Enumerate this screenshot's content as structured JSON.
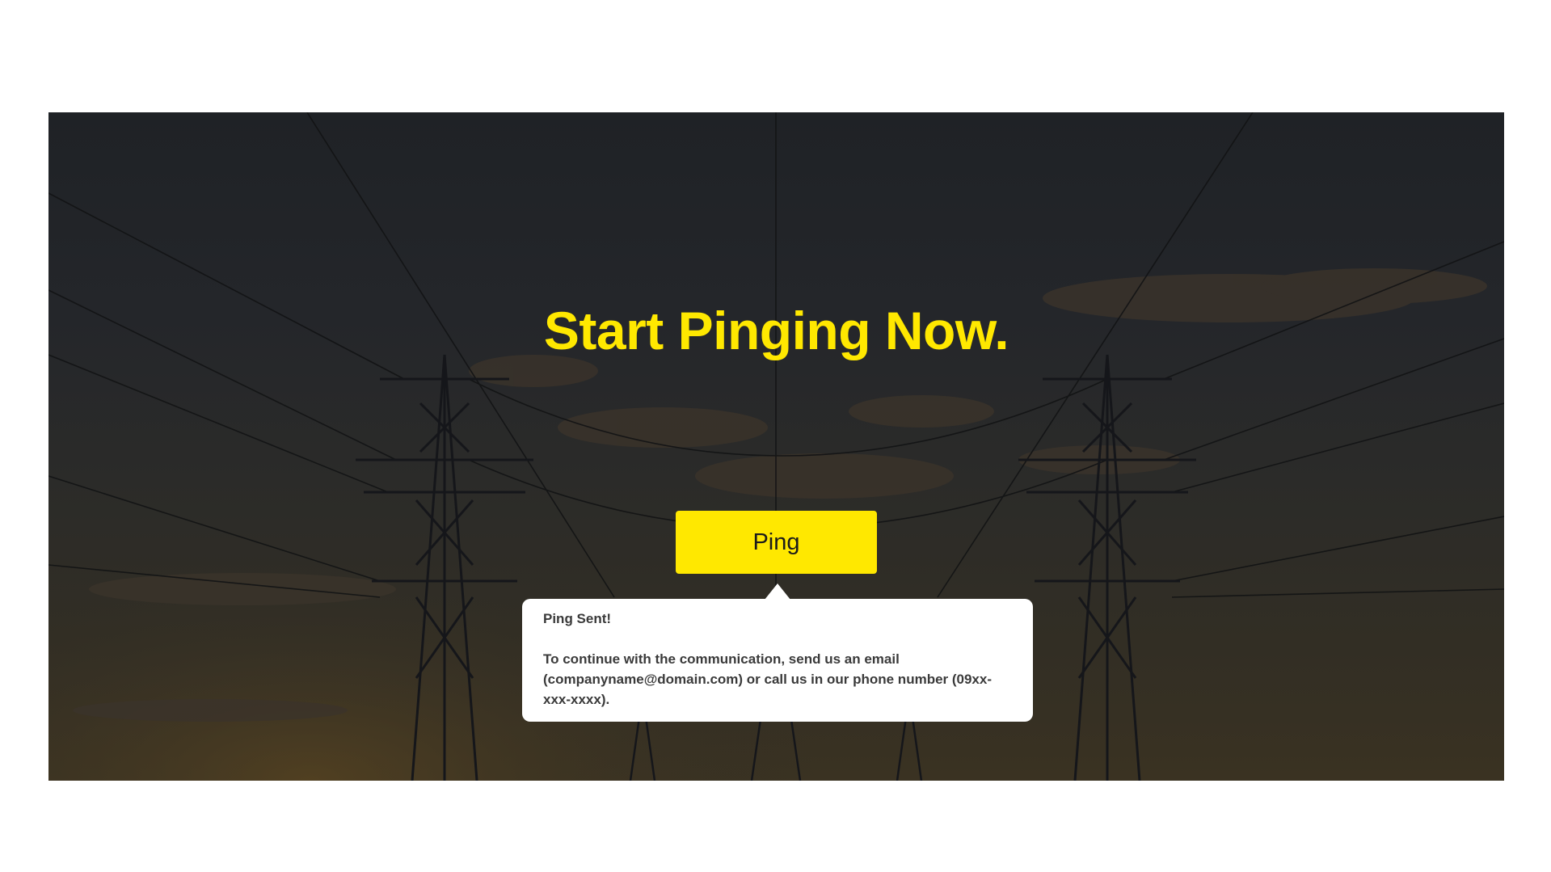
{
  "hero": {
    "title": "Start Pinging Now.",
    "title_color": "#ffe800"
  },
  "ping_button": {
    "label": "Ping",
    "color": "#ffe800"
  },
  "tooltip": {
    "title": "Ping Sent!",
    "message": "To continue with the communication, send us an email (companyname@domain.com) or call us in our phone number (09xx-xxx-xxxx)."
  }
}
